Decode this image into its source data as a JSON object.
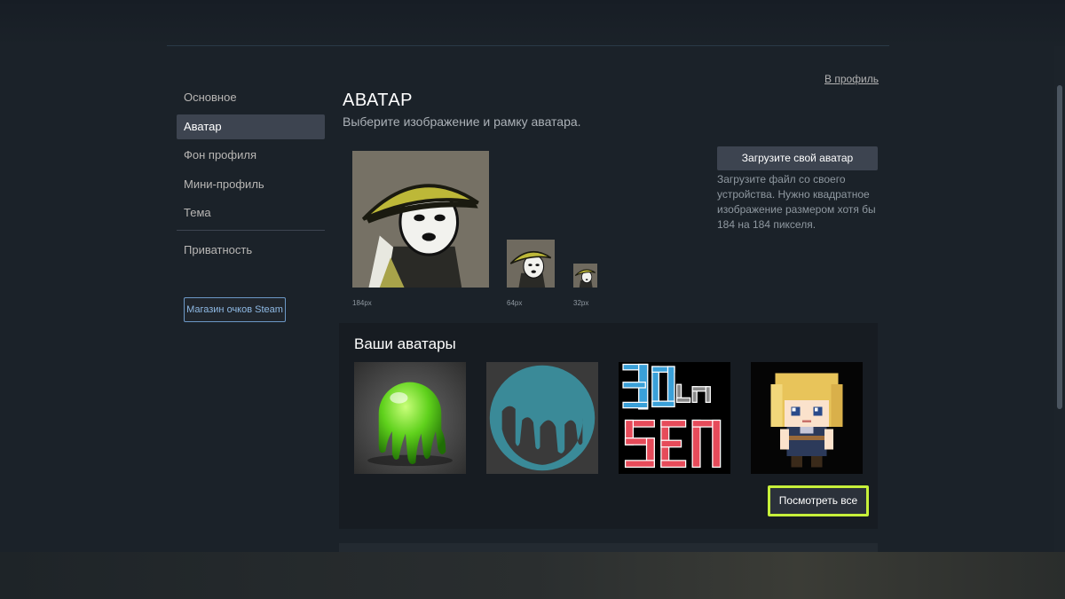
{
  "sidebar": {
    "items": [
      {
        "label": "Основное"
      },
      {
        "label": "Аватар"
      },
      {
        "label": "Фон профиля"
      },
      {
        "label": "Мини-профиль"
      },
      {
        "label": "Тема"
      },
      {
        "label": "Приватность"
      }
    ],
    "store_button": "Магазин очков Steam"
  },
  "header": {
    "profile_link": "В профиль",
    "title": "АВАТАР",
    "subtitle": "Выберите изображение и рамку аватара."
  },
  "current_avatar": {
    "sizes": [
      "184px",
      "64px",
      "32px"
    ]
  },
  "upload": {
    "button": "Загрузите свой аватар",
    "description": "Загрузите файл со своего устройства. Нужно квадратное изображение размером хотя бы 184 на 184 пикселя."
  },
  "your_avatars": {
    "title": "Ваши аватары",
    "items": [
      {
        "icon": "green-slime-sphere-avatar"
      },
      {
        "icon": "teal-drip-circle-avatar"
      },
      {
        "icon": "3d-pixel-text-avatar"
      },
      {
        "icon": "pixel-blonde-girl-avatar"
      }
    ],
    "view_all_button": "Посмотреть все"
  },
  "colors": {
    "background": "#1b2229",
    "active_nav": "#3d4450",
    "highlight_border": "#c7f03a",
    "store_border": "#6c98c6"
  }
}
